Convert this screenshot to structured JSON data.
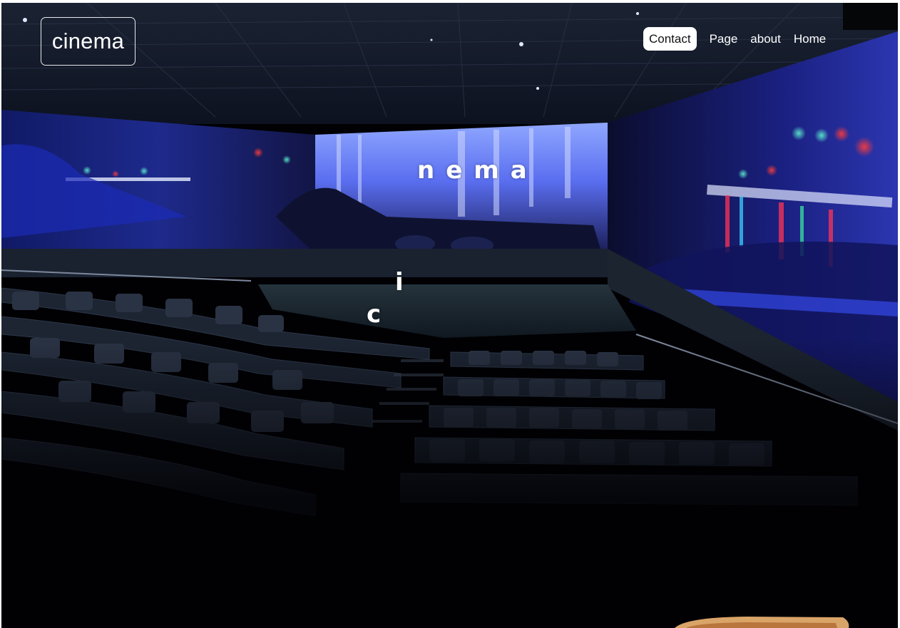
{
  "header": {
    "logo_text": "cinema"
  },
  "nav": {
    "items": [
      {
        "label": "Contact",
        "active": true
      },
      {
        "label": "Page",
        "active": false
      },
      {
        "label": "about",
        "active": false
      },
      {
        "label": "Home",
        "active": false
      }
    ]
  },
  "hero": {
    "letter_c": "c",
    "letter_i": "i",
    "letters_nema": "nema"
  },
  "colors": {
    "background": "#010104",
    "screen_blue": "#3a55d9",
    "nav_active_bg": "#ffffff"
  }
}
